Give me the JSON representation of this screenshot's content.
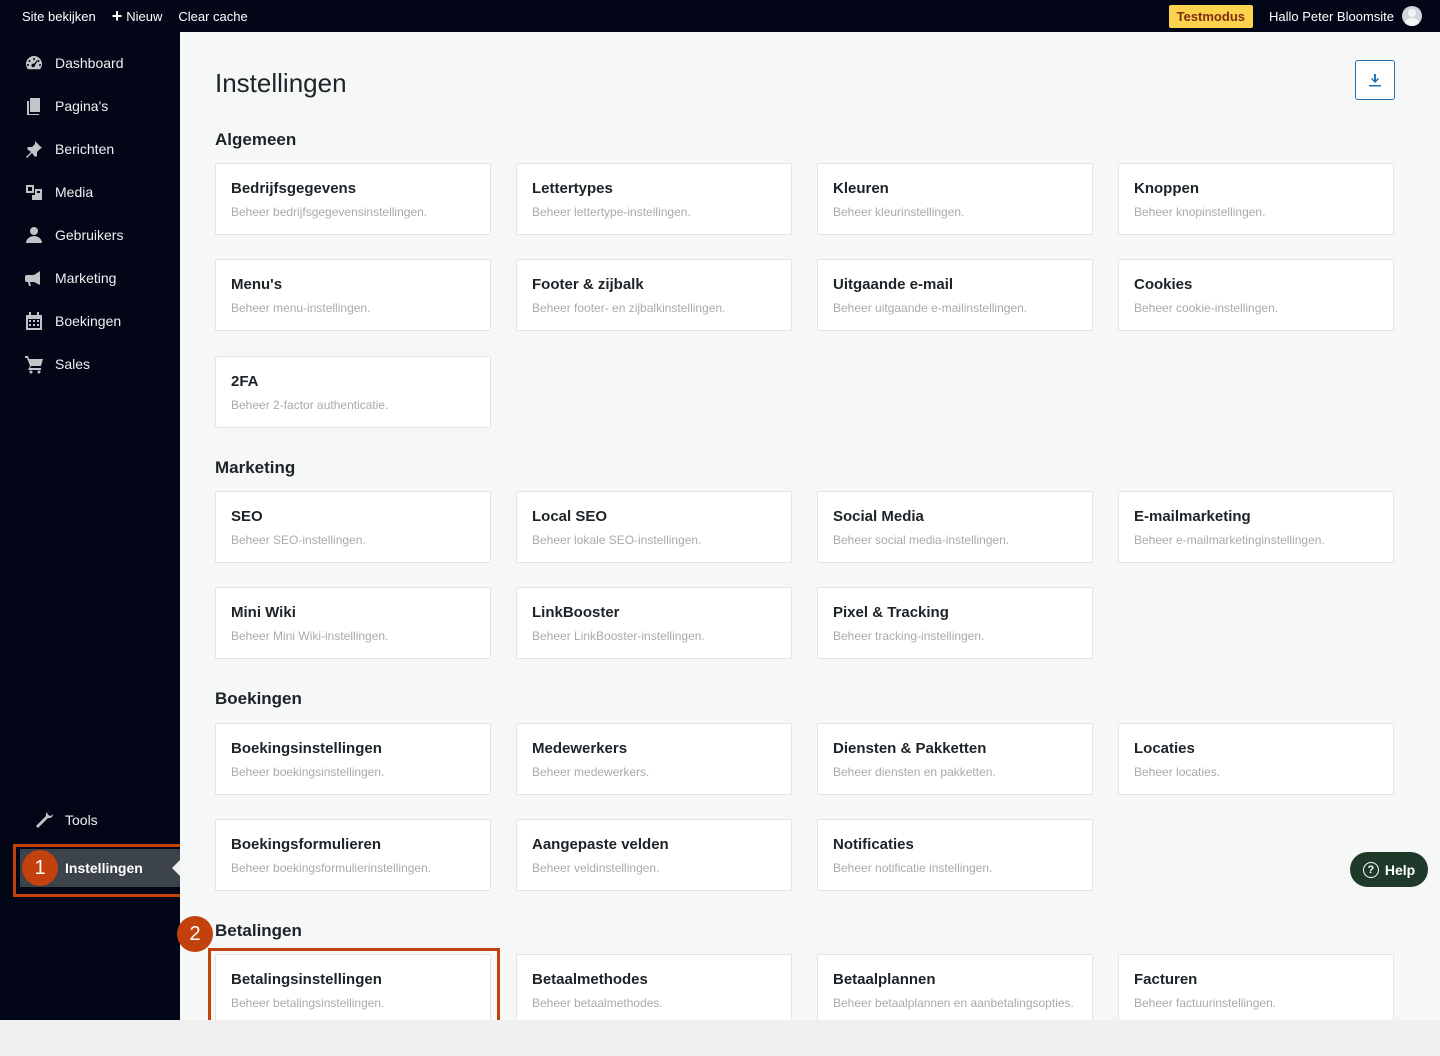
{
  "topbar": {
    "view_site": "Site bekijken",
    "new": "Nieuw",
    "clear_cache": "Clear cache",
    "test_mode": "Testmodus",
    "greeting": "Hallo Peter Bloomsite"
  },
  "sidebar": {
    "items": [
      {
        "label": "Dashboard",
        "icon": "dashboard-icon"
      },
      {
        "label": "Pagina's",
        "icon": "pages-icon"
      },
      {
        "label": "Berichten",
        "icon": "pin-icon"
      },
      {
        "label": "Media",
        "icon": "media-icon"
      },
      {
        "label": "Gebruikers",
        "icon": "user-icon"
      },
      {
        "label": "Marketing",
        "icon": "megaphone-icon"
      },
      {
        "label": "Boekingen",
        "icon": "calendar-icon"
      },
      {
        "label": "Sales",
        "icon": "cart-icon"
      }
    ],
    "tools": "Tools",
    "settings": "Instellingen",
    "step1": "1"
  },
  "main": {
    "title": "Instellingen",
    "sections": [
      {
        "title": "Algemeen",
        "cards": [
          {
            "title": "Bedrijfsgegevens",
            "desc": "Beheer bedrijfsgegevensinstellingen."
          },
          {
            "title": "Lettertypes",
            "desc": "Beheer lettertype-instellingen."
          },
          {
            "title": "Kleuren",
            "desc": "Beheer kleurinstellingen."
          },
          {
            "title": "Knoppen",
            "desc": "Beheer knopinstellingen."
          },
          {
            "title": "Menu's",
            "desc": "Beheer menu-instellingen."
          },
          {
            "title": "Footer & zijbalk",
            "desc": "Beheer footer- en zijbalkinstellingen."
          },
          {
            "title": "Uitgaande e-mail",
            "desc": "Beheer uitgaande e-mailinstellingen."
          },
          {
            "title": "Cookies",
            "desc": "Beheer cookie-instellingen."
          },
          {
            "title": "2FA",
            "desc": "Beheer 2-factor authenticatie."
          }
        ]
      },
      {
        "title": "Marketing",
        "cards": [
          {
            "title": "SEO",
            "desc": "Beheer SEO-instellingen."
          },
          {
            "title": "Local SEO",
            "desc": "Beheer lokale SEO-instellingen."
          },
          {
            "title": "Social Media",
            "desc": "Beheer social media-instellingen."
          },
          {
            "title": "E-mailmarketing",
            "desc": "Beheer e-mailmarketinginstellingen."
          },
          {
            "title": "Mini Wiki",
            "desc": "Beheer Mini Wiki-instellingen."
          },
          {
            "title": "LinkBooster",
            "desc": "Beheer LinkBooster-instellingen."
          },
          {
            "title": "Pixel & Tracking",
            "desc": "Beheer tracking-instellingen."
          }
        ]
      },
      {
        "title": "Boekingen",
        "cards": [
          {
            "title": "Boekingsinstellingen",
            "desc": "Beheer boekingsinstellingen."
          },
          {
            "title": "Medewerkers",
            "desc": "Beheer medewerkers."
          },
          {
            "title": "Diensten & Pakketten",
            "desc": "Beheer diensten en pakketten."
          },
          {
            "title": "Locaties",
            "desc": "Beheer locaties."
          },
          {
            "title": "Boekingsformulieren",
            "desc": "Beheer boekingsformulierinstellingen."
          },
          {
            "title": "Aangepaste velden",
            "desc": "Beheer veldinstellingen."
          },
          {
            "title": "Notificaties",
            "desc": "Beheer notificatie instellingen."
          }
        ]
      },
      {
        "title": "Betalingen",
        "cards": [
          {
            "title": "Betalingsinstellingen",
            "desc": "Beheer betalingsinstellingen."
          },
          {
            "title": "Betaalmethodes",
            "desc": "Beheer betaalmethodes."
          },
          {
            "title": "Betaalplannen",
            "desc": "Beheer betaalplannen en aanbetalingsopties."
          },
          {
            "title": "Facturen",
            "desc": "Beheer factuurinstellingen."
          }
        ]
      }
    ],
    "step2": "2",
    "help": "Help"
  },
  "colors": {
    "sidebar_bg": "#020617",
    "accent_orange": "#c2410c",
    "badge_yellow": "#fcd34d",
    "help_green": "#1f3a2b",
    "link_blue": "#2271b1"
  }
}
